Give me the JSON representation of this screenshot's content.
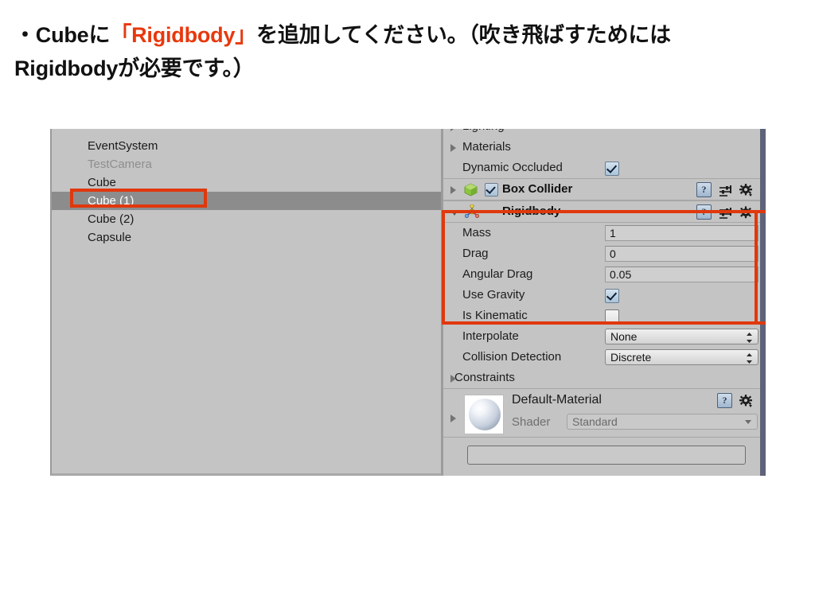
{
  "caption": {
    "line1_pre": "・Cubeに",
    "line1_accent": "「Rigidbody」",
    "line1_post": "を追加してください。（吹き飛ばすためには",
    "line2": "Rigidbodyが必要です。）"
  },
  "colors": {
    "accent_red": "#e8380d",
    "marker_red": "#e0380d",
    "panel_bg": "#c4c4c4",
    "selected_row": "#8c8c8c",
    "scrollbar": "#5e637a"
  },
  "hierarchy": {
    "items": [
      {
        "label": "EventSystem",
        "state": "normal"
      },
      {
        "label": "TestCamera",
        "state": "inactive"
      },
      {
        "label": "Cube",
        "state": "normal"
      },
      {
        "label": "Cube (1)",
        "state": "selected"
      },
      {
        "label": "Cube (2)",
        "state": "normal"
      },
      {
        "label": "Capsule",
        "state": "normal"
      }
    ]
  },
  "inspector": {
    "clipped_row": {
      "label": "Lighting"
    },
    "renderer_rows": [
      {
        "label": "Materials",
        "type": "foldout"
      }
    ],
    "dynamic_occluded": {
      "label": "Dynamic Occluded",
      "checked": "true"
    },
    "box_collider": {
      "title": "Box Collider",
      "enabled": "true",
      "icon": "cube-icon",
      "help_icon": "?",
      "preset_icon": "preset-icon",
      "gear_icon": "gear-icon"
    },
    "rigidbody": {
      "title": "Rigidbody",
      "icon": "rigidbody-axis-icon",
      "help_icon": "?",
      "preset_icon": "preset-icon",
      "gear_icon": "gear-icon",
      "properties": [
        {
          "label": "Mass",
          "type": "text",
          "value": "1"
        },
        {
          "label": "Drag",
          "type": "text",
          "value": "0"
        },
        {
          "label": "Angular Drag",
          "type": "text",
          "value": "0.05"
        },
        {
          "label": "Use Gravity",
          "type": "checkbox",
          "value": "true"
        },
        {
          "label": "Is Kinematic",
          "type": "checkbox",
          "value": "false"
        },
        {
          "label": "Interpolate",
          "type": "popup",
          "value": "None"
        },
        {
          "label": "Collision Detection",
          "type": "popup",
          "value": "Discrete"
        },
        {
          "label": "Constraints",
          "type": "foldout",
          "value": ""
        }
      ]
    },
    "material": {
      "name": "Default-Material",
      "shader_label": "Shader",
      "shader_value": "Standard",
      "help_icon": "?",
      "gear_icon": "gear-icon",
      "preview_icon": "material-sphere-preview"
    }
  }
}
